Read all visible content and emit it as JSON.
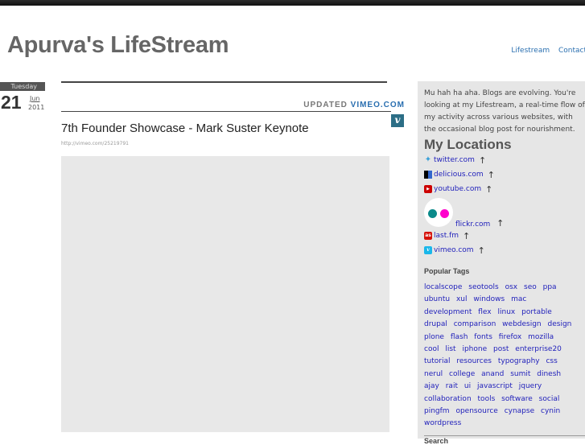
{
  "header": {
    "title": "Apurva's LifeStream",
    "nav": [
      "Lifestream",
      "Contact"
    ]
  },
  "post": {
    "date": {
      "weekday": "Tuesday",
      "day": "21",
      "month": "Jun",
      "year": "2011"
    },
    "updated_label": "UPDATED",
    "source": "VIMEO.COM",
    "title": "7th Founder Showcase - Mark Suster Keynote",
    "url": "http://vimeo.com/25219791",
    "badge": "v"
  },
  "sidebar": {
    "intro": "Mu hah ha aha. Blogs are evolving. You're looking at my Lifestream, a real-time flow of my activity across various websites, with the occasional blog post for nourishment.",
    "locations_title": "My Locations",
    "locations": [
      {
        "label": "twitter.com",
        "icon": "twitter-icon"
      },
      {
        "label": "delicious.com",
        "icon": "delicious-icon"
      },
      {
        "label": "youtube.com",
        "icon": "youtube-icon"
      },
      {
        "label": "flickr.com",
        "icon": "flickr-icon"
      },
      {
        "label": "last.fm",
        "icon": "lastfm-icon"
      },
      {
        "label": "vimeo.com",
        "icon": "vimeo-icon"
      }
    ],
    "up_arrow": "↑",
    "tags_title": "Popular Tags",
    "tags": [
      "localscope",
      "seotools",
      "osx",
      "seo",
      "ppa",
      "ubuntu",
      "xul",
      "windows",
      "mac",
      "development",
      "flex",
      "linux",
      "portable",
      "drupal",
      "comparison",
      "webdesign",
      "design",
      "plone",
      "flash",
      "fonts",
      "firefox",
      "mozilla",
      "cool",
      "list",
      "iphone",
      "post",
      "enterprise20",
      "tutorial",
      "resources",
      "typography",
      "css",
      "nerul",
      "college",
      "anand",
      "sumit",
      "dinesh",
      "ajay",
      "rait",
      "ui",
      "javascript",
      "jquery",
      "collaboration",
      "tools",
      "software",
      "social",
      "pingfm",
      "opensource",
      "cynapse",
      "cynin",
      "wordpress"
    ],
    "search_title": "Search"
  },
  "colors": {
    "accent": "#2a6fb0",
    "sidebar_bg": "#e6e6e6",
    "vimeo_badge": "#2c6e86"
  }
}
